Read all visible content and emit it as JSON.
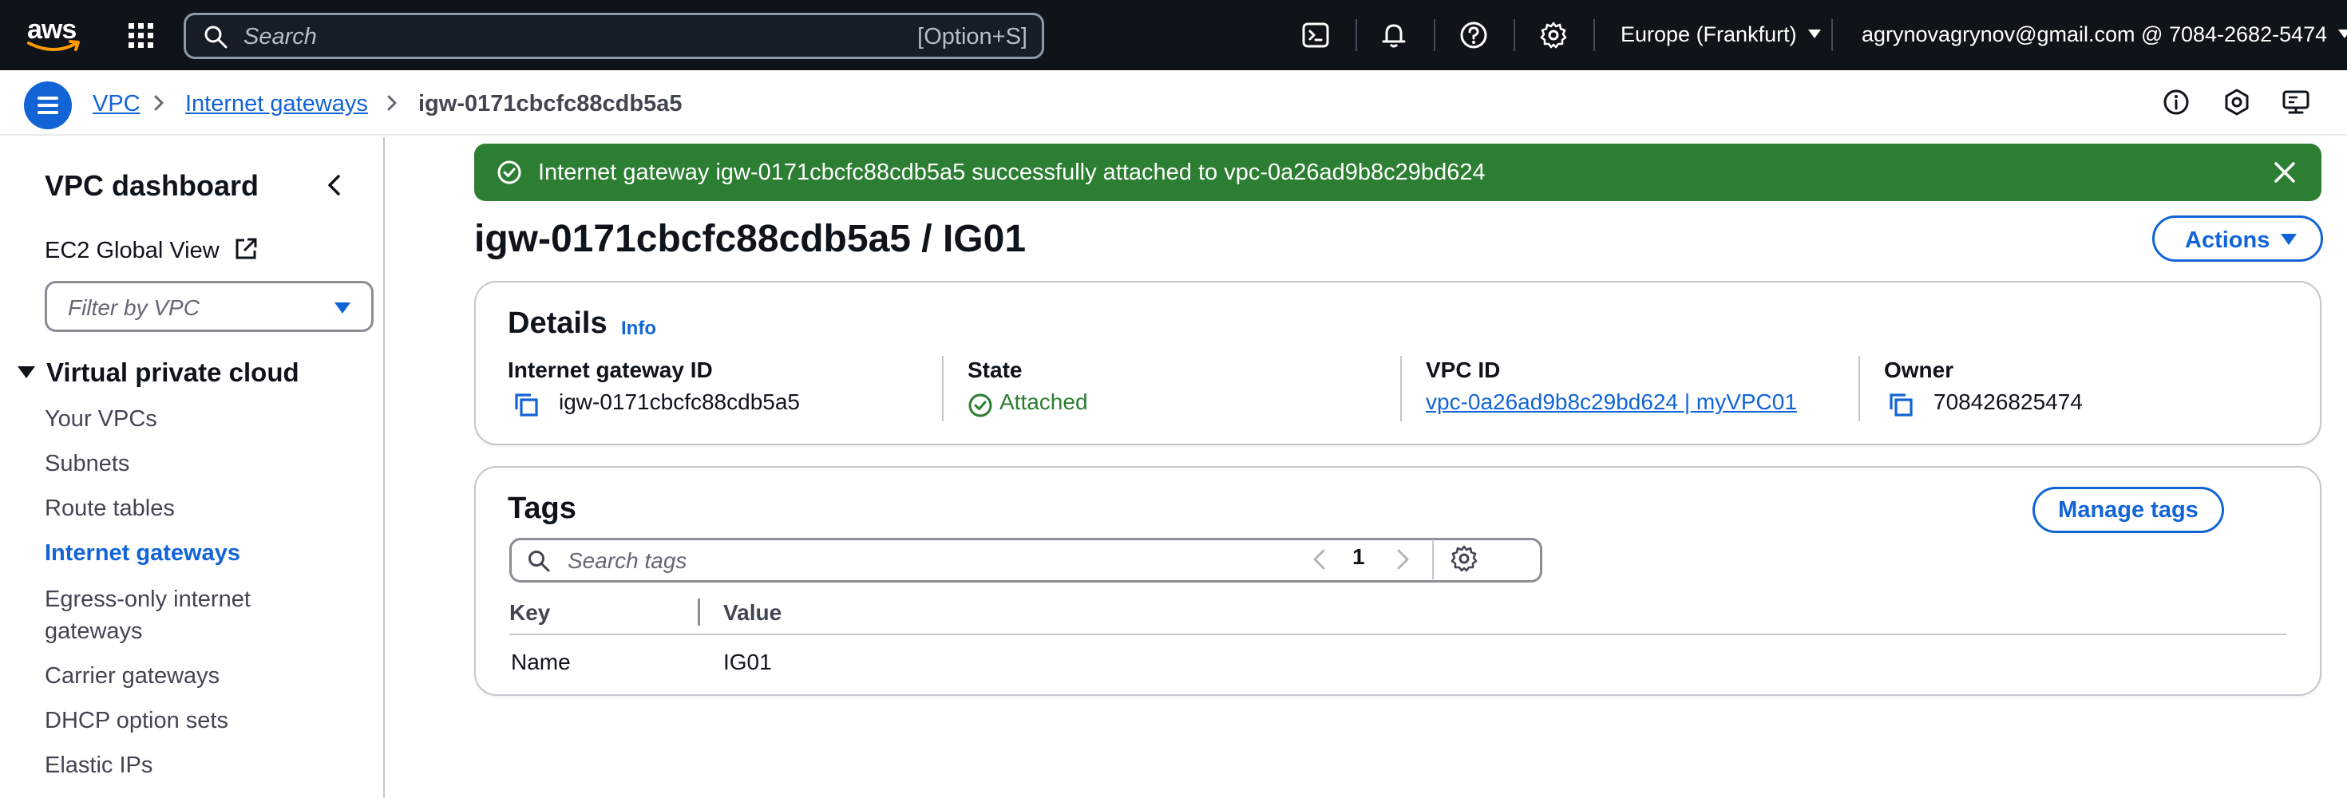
{
  "topnav": {
    "logo_text": "aws",
    "search_placeholder": "Search",
    "search_shortcut": "[Option+S]",
    "region": "Europe (Frankfurt)",
    "account": "agrynovagrynov@gmail.com @ 7084-2682-5474",
    "icons": [
      "cloudshell-icon",
      "bell-icon",
      "help-icon",
      "gear-icon"
    ]
  },
  "breadcrumb": {
    "items": [
      "VPC",
      "Internet gateways"
    ],
    "current": "igw-0171cbcfc88cdb5a5"
  },
  "sidebar": {
    "title": "VPC dashboard",
    "global_view": "EC2 Global View",
    "filter_placeholder": "Filter by VPC",
    "section": "Virtual private cloud",
    "items": [
      "Your VPCs",
      "Subnets",
      "Route tables",
      "Internet gateways",
      "Egress-only internet gateways",
      "Carrier gateways",
      "DHCP option sets",
      "Elastic IPs"
    ],
    "active_index": 3
  },
  "flash": {
    "message": "Internet gateway igw-0171cbcfc88cdb5a5 successfully attached to vpc-0a26ad9b8c29bd624",
    "color": "#2c7e32"
  },
  "page": {
    "title": "igw-0171cbcfc88cdb5a5 / IG01",
    "actions_label": "Actions"
  },
  "details": {
    "heading": "Details",
    "info": "Info",
    "columns": [
      {
        "label": "Internet gateway ID",
        "value": "igw-0171cbcfc88cdb5a5"
      },
      {
        "label": "State",
        "value": "Attached"
      },
      {
        "label": "VPC ID",
        "value": "vpc-0a26ad9b8c29bd624 | myVPC01"
      },
      {
        "label": "Owner",
        "value": "708426825474"
      }
    ]
  },
  "tags": {
    "heading": "Tags",
    "manage_label": "Manage tags",
    "search_placeholder": "Search tags",
    "page": "1",
    "headers": [
      "Key",
      "Value"
    ],
    "rows": [
      {
        "key": "Name",
        "value": "IG01"
      }
    ]
  },
  "colors": {
    "accent": "#1264d6",
    "nav_bg": "#0f141a",
    "success": "#2c7e32"
  }
}
